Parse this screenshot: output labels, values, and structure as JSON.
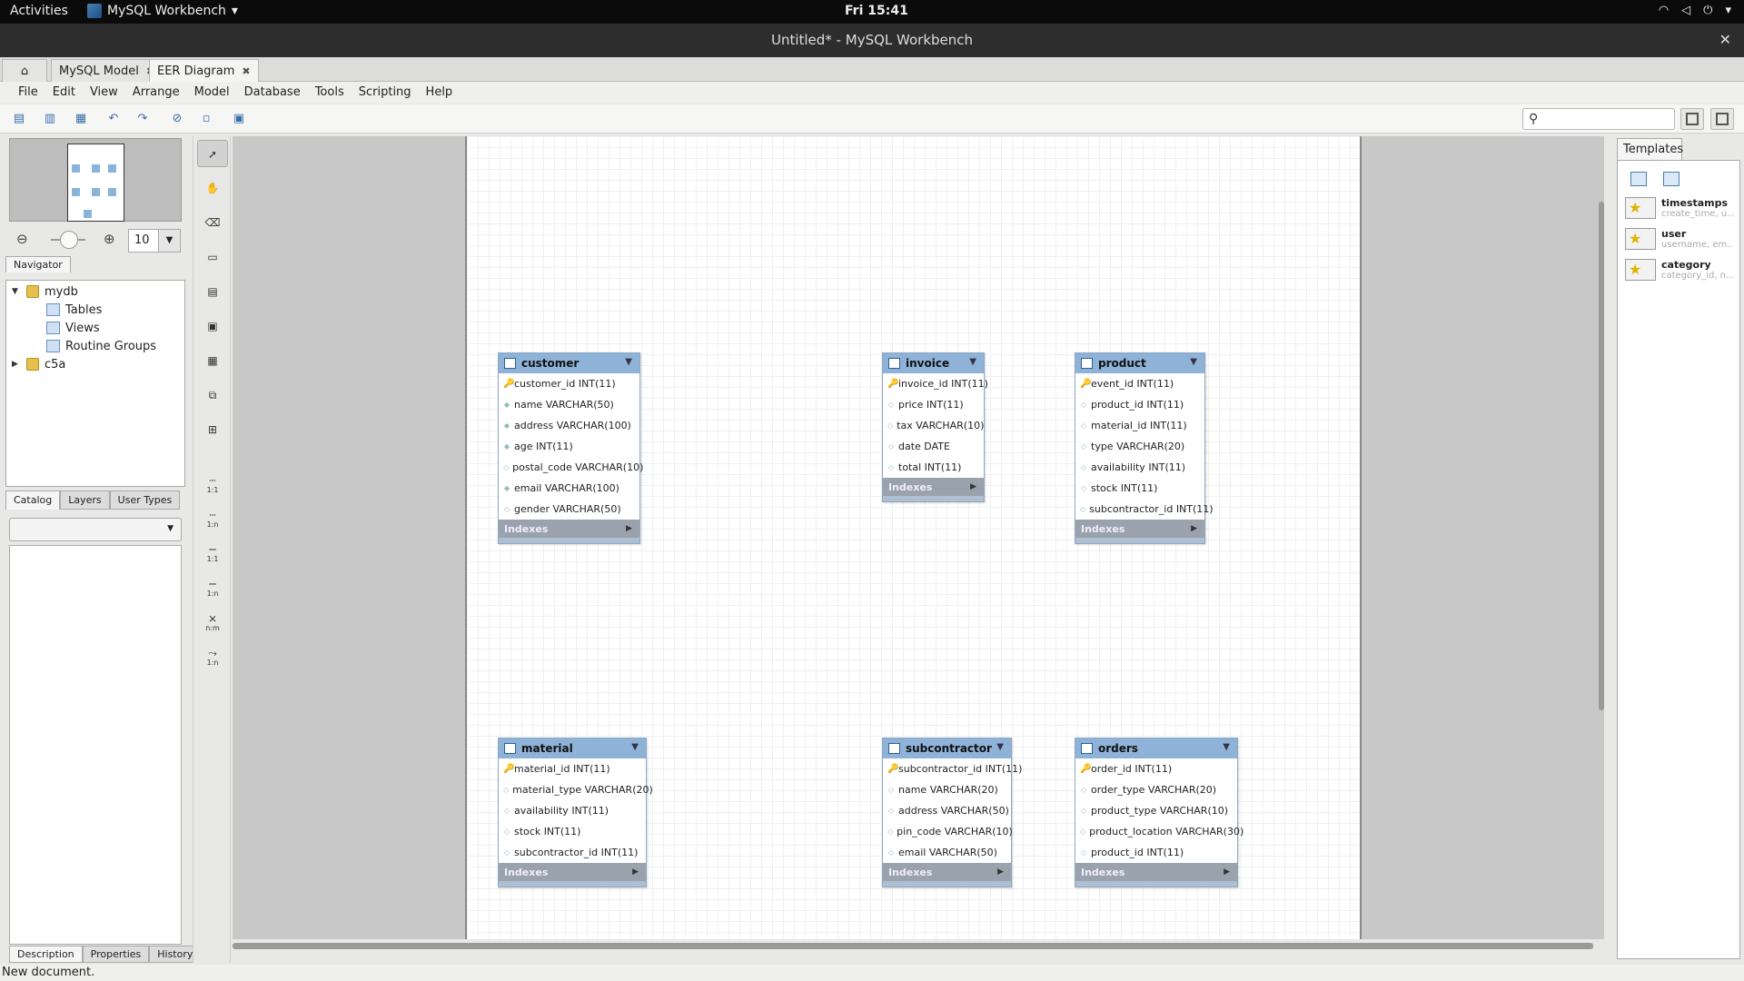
{
  "topbar": {
    "activities": "Activities",
    "app_name": "MySQL Workbench",
    "clock": "Fri 15:41"
  },
  "window": {
    "title": "Untitled* - MySQL Workbench"
  },
  "tabs": [
    {
      "label": "MySQL Model"
    },
    {
      "label": "EER Diagram"
    }
  ],
  "menu": [
    "File",
    "Edit",
    "View",
    "Arrange",
    "Model",
    "Database",
    "Tools",
    "Scripting",
    "Help"
  ],
  "navigator": {
    "zoom_value": "10",
    "tab_label": "Navigator"
  },
  "catalog": {
    "tree": [
      {
        "label": "mydb"
      },
      {
        "label": "Tables"
      },
      {
        "label": "Views"
      },
      {
        "label": "Routine Groups"
      },
      {
        "label": "c5a"
      }
    ],
    "tabs": [
      "Catalog",
      "Layers",
      "User Types"
    ]
  },
  "description_tabs": [
    "Description",
    "Properties",
    "History"
  ],
  "palette_labels": {
    "one_to_one": "1:1",
    "one_to_n": "1:n",
    "one_to_one_b": "1:1",
    "one_to_n_b": "1:n",
    "n_to_m": "n:m",
    "one_to_n_c": "1:n"
  },
  "indexes_label": "Indexes",
  "tables": {
    "customer": {
      "name": "customer",
      "columns": [
        "customer_id INT(11)",
        "name VARCHAR(50)",
        "address VARCHAR(100)",
        "age INT(11)",
        "postal_code VARCHAR(10)",
        "email VARCHAR(100)",
        "gender VARCHAR(50)"
      ]
    },
    "invoice": {
      "name": "invoice",
      "columns": [
        "invoice_id INT(11)",
        "price INT(11)",
        "tax VARCHAR(10)",
        "date DATE",
        "total INT(11)"
      ]
    },
    "product": {
      "name": "product",
      "columns": [
        "event_id INT(11)",
        "product_id INT(11)",
        "material_id INT(11)",
        "type VARCHAR(20)",
        "availability INT(11)",
        "stock INT(11)",
        "subcontractor_id INT(11)"
      ]
    },
    "material": {
      "name": "material",
      "columns": [
        "material_id INT(11)",
        "material_type VARCHAR(20)",
        "availability INT(11)",
        "stock INT(11)",
        "subcontractor_id INT(11)"
      ]
    },
    "subcontractor": {
      "name": "subcontractor",
      "columns": [
        "subcontractor_id INT(11)",
        "name VARCHAR(20)",
        "address VARCHAR(50)",
        "pin_code VARCHAR(10)",
        "email VARCHAR(50)"
      ]
    },
    "orders": {
      "name": "orders",
      "columns": [
        "order_id INT(11)",
        "order_type VARCHAR(20)",
        "product_type VARCHAR(10)",
        "product_location VARCHAR(30)",
        "product_id INT(11)"
      ]
    }
  },
  "templates": {
    "panel_label": "Templates",
    "items": [
      {
        "name": "timestamps",
        "sub": "create_time, u..."
      },
      {
        "name": "user",
        "sub": "username, em..."
      },
      {
        "name": "category",
        "sub": "category_id, n..."
      }
    ]
  },
  "status": "New document.",
  "colors": {
    "table_header": "#8eb2d8",
    "index_bar": "#9aa3ad",
    "pk_key": "#e0b000"
  }
}
